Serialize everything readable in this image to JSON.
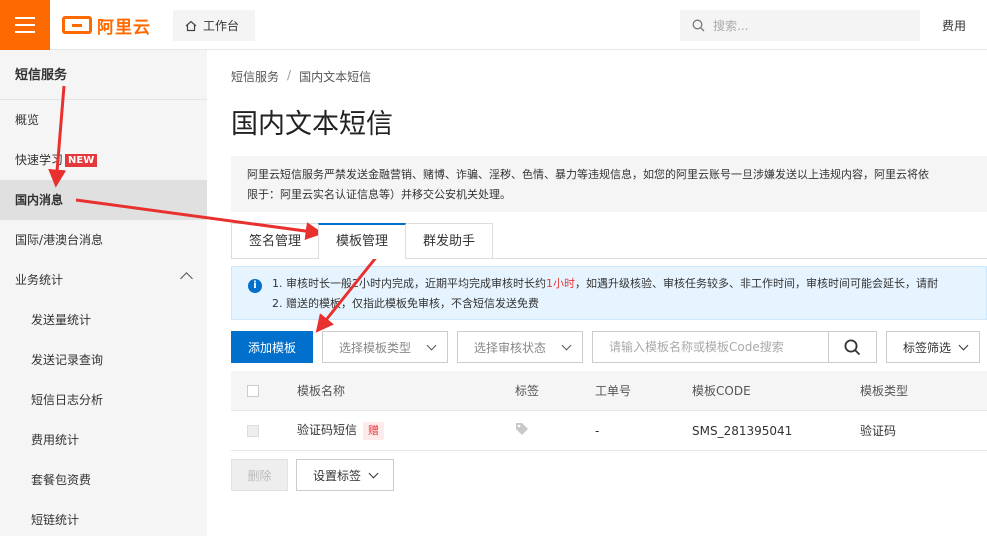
{
  "topbar": {
    "logo_text": "阿里云",
    "workbench_label": "工作台",
    "search_placeholder": "搜索...",
    "fee_label": "费用"
  },
  "sidebar": {
    "title": "短信服务",
    "items": [
      {
        "label": "概览"
      },
      {
        "label": "快速学习",
        "badge": "NEW"
      },
      {
        "label": "国内消息"
      },
      {
        "label": "国际/港澳台消息"
      },
      {
        "label": "业务统计"
      },
      {
        "label": "发送量统计"
      },
      {
        "label": "发送记录查询"
      },
      {
        "label": "短信日志分析"
      },
      {
        "label": "费用统计"
      },
      {
        "label": "套餐包资费"
      },
      {
        "label": "短链统计"
      }
    ]
  },
  "breadcrumb": [
    "短信服务",
    "国内文本短信"
  ],
  "page_title": "国内文本短信",
  "notice": {
    "line1": "阿里云短信服务严禁发送金融营销、赌博、诈骗、淫秽、色情、暴力等违规信息，如您的阿里云账号一旦涉嫌发送以上违规内容，阿里云将依",
    "line2": "限于：阿里云实名认证信息等）并移交公安机关处理。"
  },
  "tabs": [
    {
      "label": "签名管理"
    },
    {
      "label": "模板管理"
    },
    {
      "label": "群发助手"
    }
  ],
  "info": {
    "icon": "i",
    "line1_a": "1. 审核时长一般2小时内完成，近期平均完成审核时长约",
    "line1_b": "1小时",
    "line1_c": "，如遇升级核验、审核任务较多、非工作时间，审核时间可能会延长，请耐",
    "line2": "2. 赠送的模板，仅指此模板免审核，不含短信发送免费"
  },
  "toolbar": {
    "add_label": "添加模板",
    "type_select": "选择模板类型",
    "status_select": "选择审核状态",
    "keyword_placeholder": "请输入模板名称或模板Code搜索",
    "tag_filter": "标签筛选"
  },
  "table": {
    "headers": [
      "模板名称",
      "标签",
      "工单号",
      "模板CODE",
      "模板类型"
    ],
    "rows": [
      {
        "name": "验证码短信",
        "gift": "赠",
        "ticket": "-",
        "code": "SMS_281395041",
        "type": "验证码"
      }
    ]
  },
  "bottom": {
    "delete_label": "删除",
    "set_tag_label": "设置标签"
  },
  "colors": {
    "brand": "#ff6a00",
    "primary": "#0070cc",
    "annotation": "#e8312f"
  }
}
